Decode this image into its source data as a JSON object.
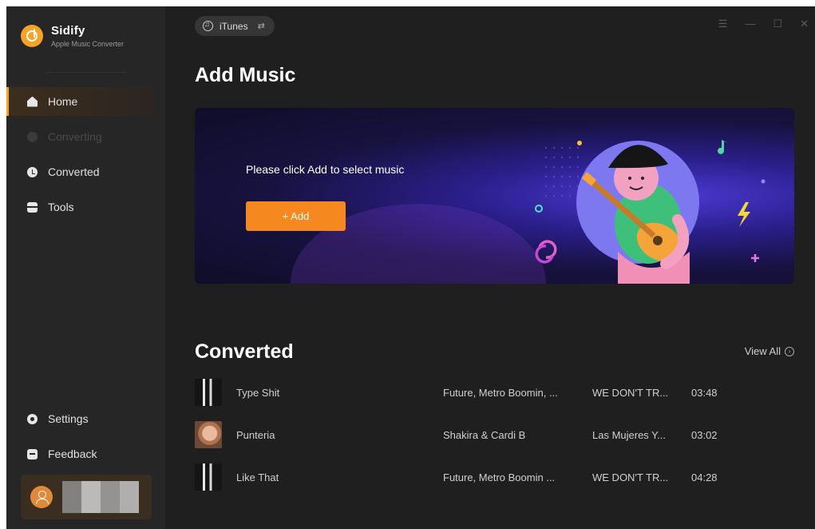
{
  "app": {
    "name": "Sidify",
    "subtitle": "Apple Music Converter"
  },
  "sidebar": {
    "items": [
      {
        "label": "Home",
        "state": "active"
      },
      {
        "label": "Converting",
        "state": "disabled"
      },
      {
        "label": "Converted",
        "state": "normal"
      },
      {
        "label": "Tools",
        "state": "normal"
      }
    ],
    "bottom_items": [
      {
        "label": "Settings"
      },
      {
        "label": "Feedback"
      }
    ]
  },
  "header": {
    "source_label": "iTunes",
    "controls": [
      "menu-icon",
      "minimize-icon",
      "maximize-icon",
      "close-icon"
    ]
  },
  "add_music": {
    "title": "Add Music",
    "banner_text": "Please click Add to select music",
    "add_button": "+ Add"
  },
  "converted": {
    "title": "Converted",
    "view_all": "View All",
    "rows": [
      {
        "title": "Type Shit",
        "artist": "Future, Metro Boomin, ...",
        "album": "WE DON'T TR...",
        "duration": "03:48"
      },
      {
        "title": "Punteria",
        "artist": "Shakira & Cardi B",
        "album": "Las Mujeres Y...",
        "duration": "03:02"
      },
      {
        "title": "Like That",
        "artist": "Future, Metro Boomin ...",
        "album": "WE DON'T TR...",
        "duration": "04:28"
      }
    ]
  },
  "colors": {
    "accent": "#f5891f",
    "sidebar_bg": "#262626",
    "main_bg": "#1f1f1f"
  }
}
